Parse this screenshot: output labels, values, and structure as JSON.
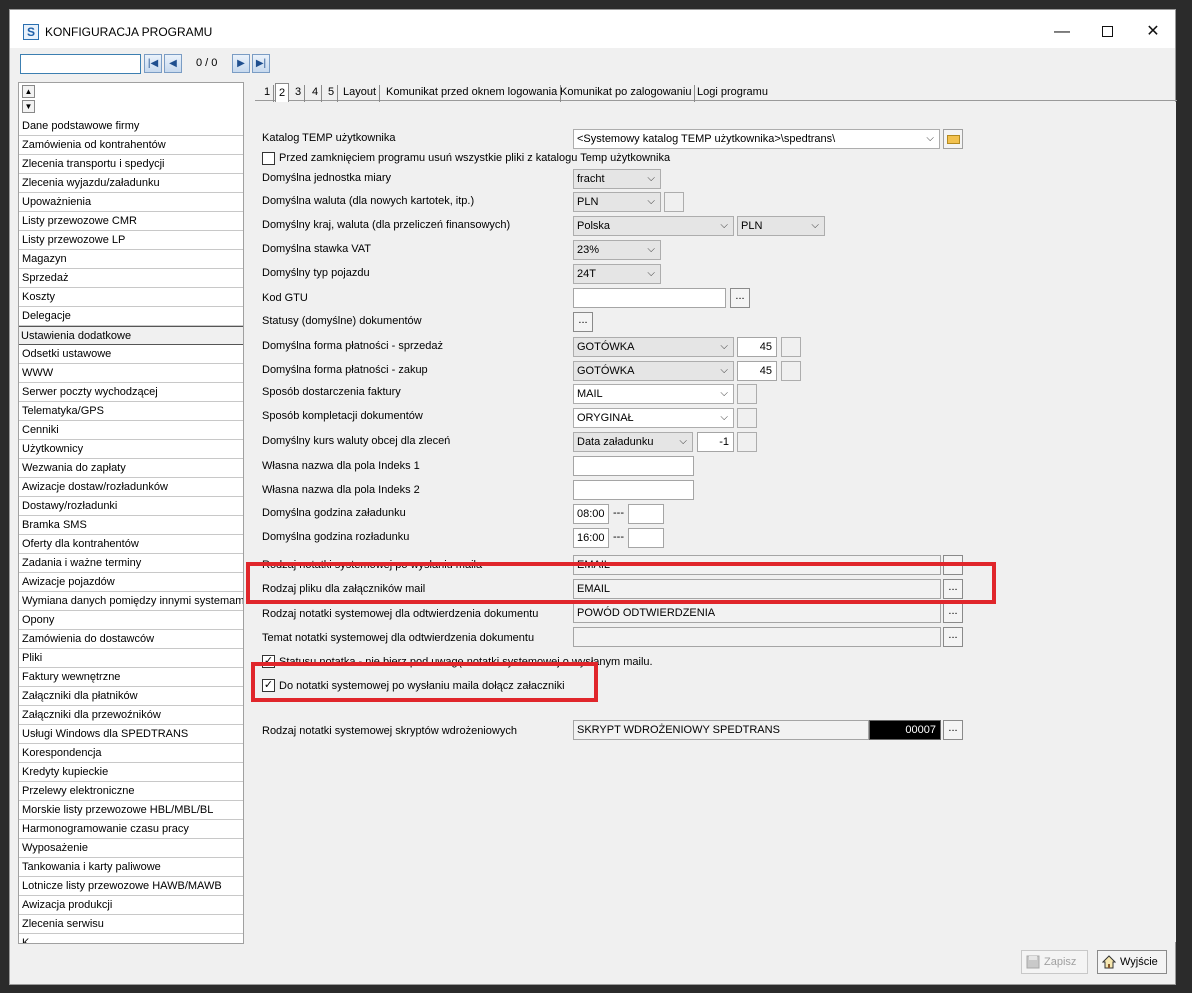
{
  "window": {
    "title": "KONFIGURACJA PROGRAMU",
    "icon_letter": "S",
    "controls": {
      "minimize": "—",
      "maximize": "",
      "close": "✕"
    }
  },
  "navigator": {
    "search_value": "",
    "first": "|◀",
    "prev": "◀",
    "count": "0 / 0",
    "next": "▶",
    "last": "▶|"
  },
  "sidebar": {
    "scroll_up": "▲",
    "scroll_down": "▼",
    "items": [
      "Dane podstawowe firmy",
      "Zamówienia od kontrahentów",
      "Zlecenia transportu i spedycji",
      "Zlecenia wyjazdu/załadunku",
      "Upoważnienia",
      "Listy przewozowe CMR",
      "Listy przewozowe LP",
      "Magazyn",
      "Sprzedaż",
      "Koszty",
      "Delegacje",
      "Ustawienia dodatkowe",
      "Odsetki ustawowe",
      "WWW",
      "Serwer poczty wychodzącej",
      "Telematyka/GPS",
      "Cenniki",
      "Użytkownicy",
      "Wezwania do zapłaty",
      "Awizacje dostaw/rozładunków",
      "Dostawy/rozładunki",
      "Bramka SMS",
      "Oferty dla kontrahentów",
      "Zadania i ważne terminy",
      "Awizacje pojazdów",
      "Wymiana danych pomiędzy innymi systemami",
      "Opony",
      "Zamówienia do dostawców",
      "Pliki",
      "Faktury wewnętrzne",
      "Załączniki dla płatników",
      "Załączniki dla przewoźników",
      "Usługi Windows dla SPEDTRANS",
      "Korespondencja",
      "Kredyty kupieckie",
      "Przelewy elektroniczne",
      "Morskie listy przewozowe HBL/MBL/BL",
      "Harmonogramowanie czasu pracy",
      "Wyposażenie",
      "Tankowania i karty paliwowe",
      "Lotnicze listy przewozowe HAWB/MAWB",
      "Awizacja produkcji",
      "Zlecenia serwisu",
      "K"
    ]
  },
  "tabs": [
    "1",
    "2",
    "3",
    "4",
    "5",
    "Layout",
    "Komunikat przed oknem logowania",
    "Komunikat po zalogowaniu",
    "Logi programu"
  ],
  "form": {
    "temp_dir_label": "Katalog TEMP użytkownika",
    "temp_dir_value": "<Systemowy katalog TEMP użytkownika>\\spedtrans\\",
    "delete_temp_label": "Przed zamknięciem programu usuń wszystkie pliki z katalogu Temp użytkownika",
    "delete_temp_checked": "",
    "unit_label": "Domyślna jednostka miary",
    "unit_value": "fracht",
    "currency_label": "Domyślna waluta (dla nowych kartotek, itp.)",
    "currency_value": "PLN",
    "country_label": "Domyślny kraj, waluta (dla przeliczeń finansowych)",
    "country_value": "Polska",
    "country_currency_value": "PLN",
    "vat_label": "Domyślna stawka VAT",
    "vat_value": "23%",
    "vehicle_label": "Domyślny typ pojazdu",
    "vehicle_value": "24T",
    "gtu_label": "Kod GTU",
    "gtu_value": "",
    "statuses_label": "Statusy (domyślne) dokumentów",
    "pay_sale_label": "Domyślna forma płatności - sprzedaż",
    "pay_sale_value": "GOTÓWKA",
    "pay_sale_days": "45",
    "pay_buy_label": "Domyślna forma płatności - zakup",
    "pay_buy_value": "GOTÓWKA",
    "pay_buy_days": "45",
    "delivery_label": "Sposób dostarczenia faktury",
    "delivery_value": "MAIL",
    "completion_label": "Sposób kompletacji dokumentów",
    "completion_value": "ORYGINAŁ",
    "rate_label": "Domyślny kurs waluty obcej dla zleceń",
    "rate_value": "Data załadunku",
    "rate_offset": "-1",
    "index1_label": "Własna nazwa dla pola Indeks 1",
    "index1_value": "",
    "index2_label": "Własna nazwa dla pola Indeks 2",
    "index2_value": "",
    "load_time_label": "Domyślna godzina załadunku",
    "load_time_value": "08:00",
    "unload_time_label": "Domyślna godzina rozładunku",
    "unload_time_value": "16:00",
    "time_sep": "---",
    "note_after_mail_label": "Rodzaj notatki systemowej po wysłaniu maila",
    "note_after_mail_value": "EMAIL",
    "attach_file_label": "Rodzaj pliku dla załączników mail",
    "attach_file_value": "EMAIL",
    "confirm_note_label": "Rodzaj notatki systemowej dla odtwierdzenia dokumentu",
    "confirm_note_value": "POWÓD ODTWIERDZENIA",
    "confirm_topic_label": "Temat notatki systemowej dla odtwierdzenia dokumentu",
    "confirm_topic_value": "",
    "status_note_label": "Statusu notatka - nie bierz pod uwagę notatki systemowej o wysłanym mailu.",
    "status_note_checked": "✓",
    "attach_checkbox_label": "Do notatki systemowej po wysłaniu maila dołącz załaczniki",
    "attach_checkbox_checked": "✓",
    "scripts_label": "Rodzaj notatki systemowej skryptów wdrożeniowych",
    "scripts_value": "SKRYPT WDROŻENIOWY SPEDTRANS",
    "scripts_code": "00007",
    "ellipsis": "..."
  },
  "footer": {
    "save_label": "Zapisz",
    "exit_label": "Wyjście"
  },
  "colors": {
    "highlight": "#e0262b",
    "accent": "#3c7fb1"
  }
}
